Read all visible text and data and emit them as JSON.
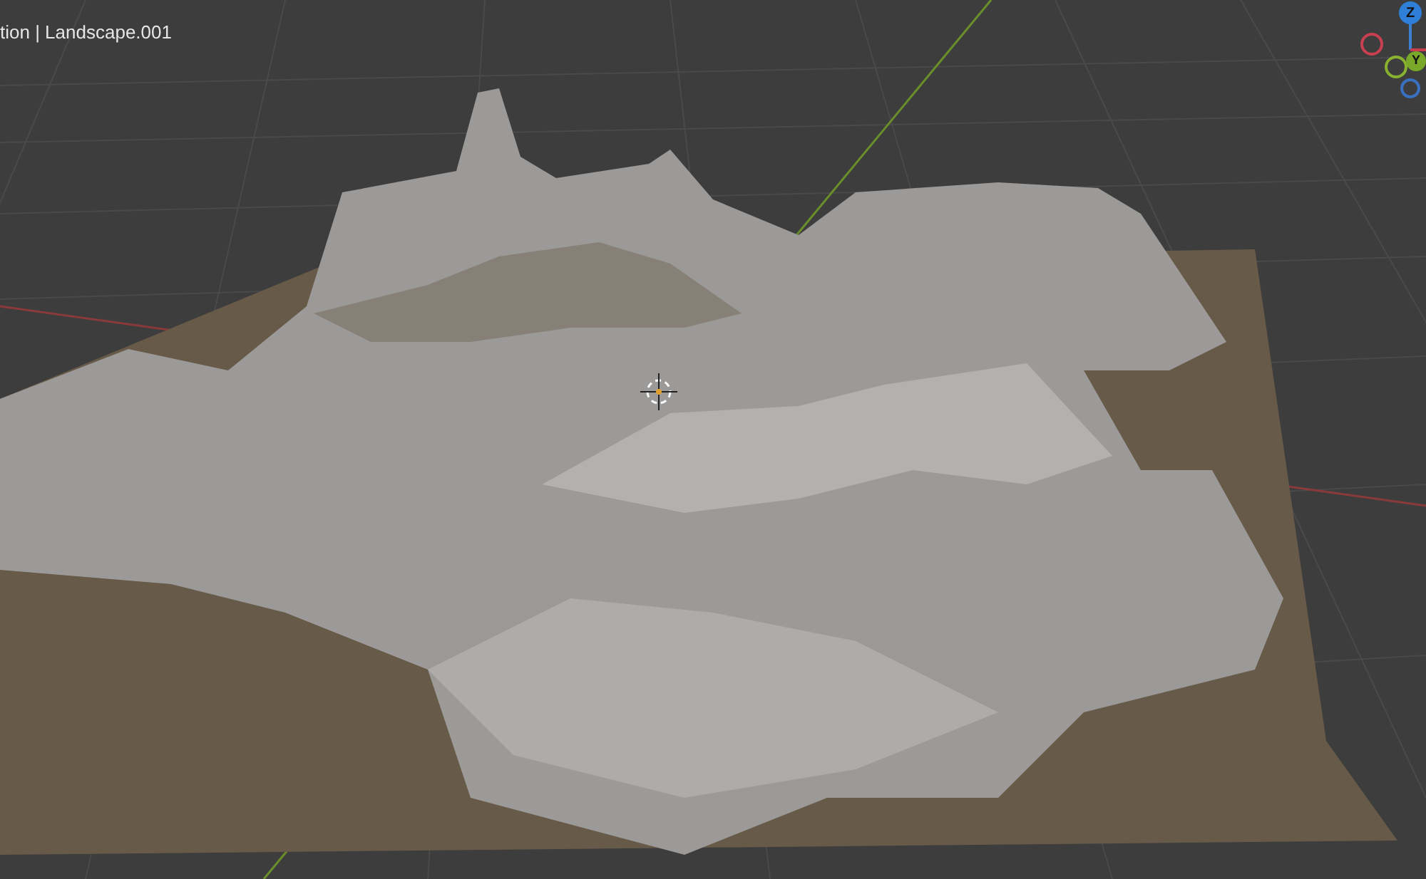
{
  "viewport": {
    "header_text": "tion | Landscape.001"
  },
  "gizmo": {
    "axes": [
      {
        "label": "Z",
        "color": "#2f7fd8"
      },
      {
        "label": "Y",
        "color": "#7aa829"
      }
    ]
  }
}
